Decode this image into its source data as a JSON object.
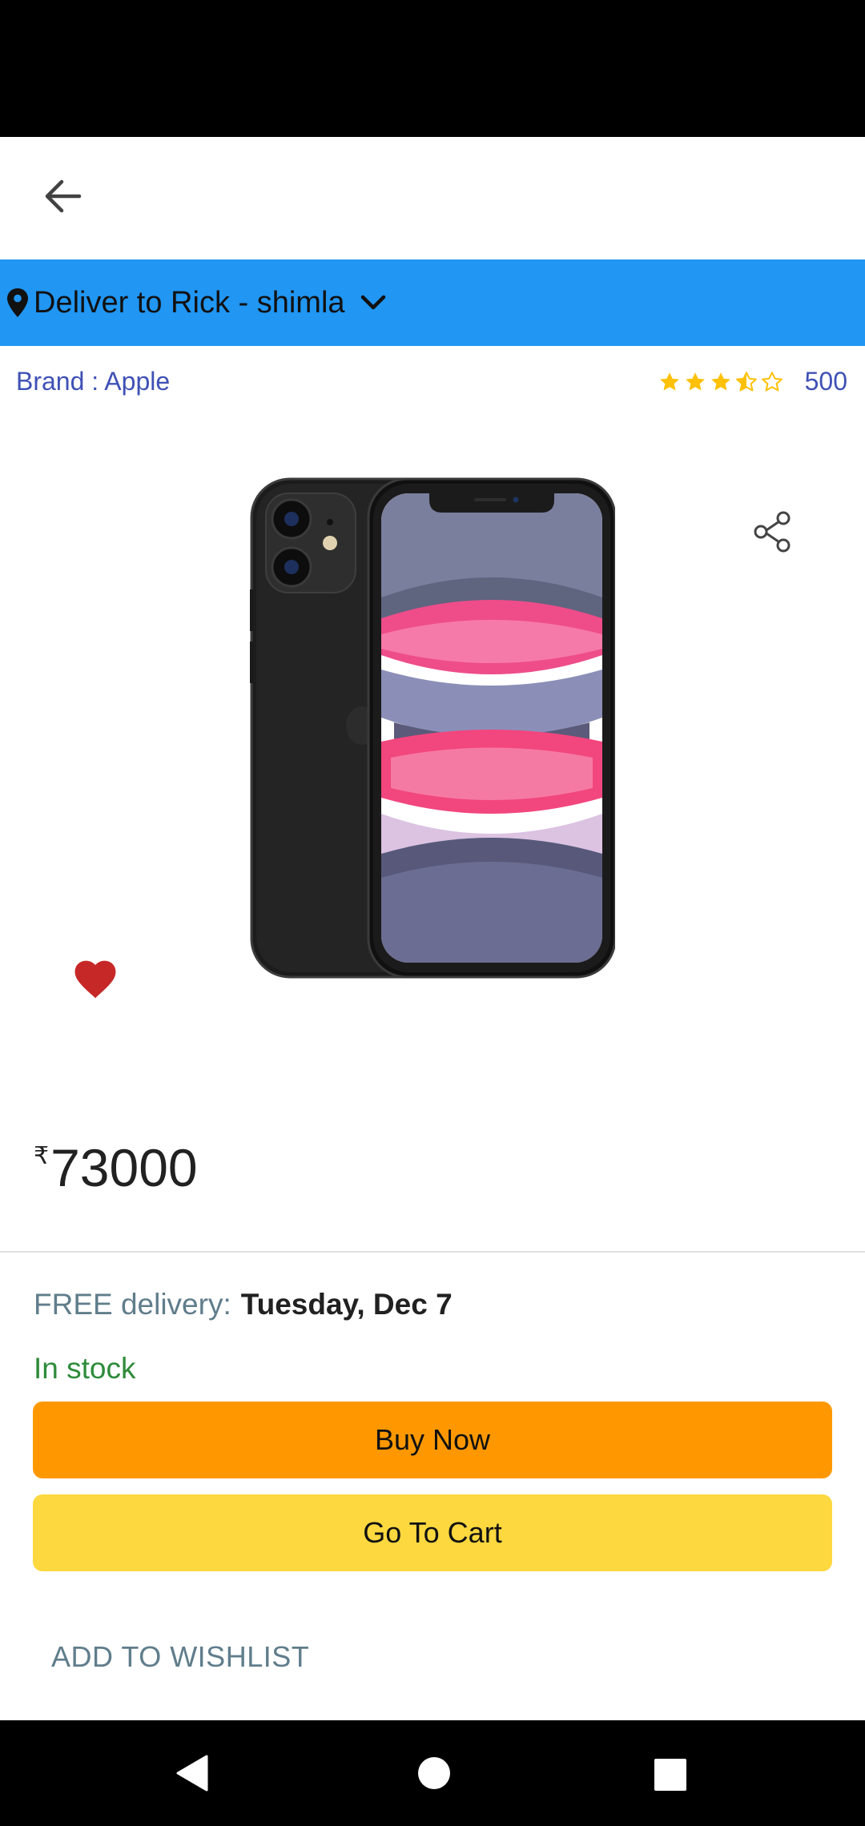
{
  "header": {
    "back_icon": "arrow-back-icon"
  },
  "delivery_bar": {
    "text": "Deliver to Rick - shimla",
    "pin_icon": "location-pin-icon",
    "chevron_icon": "chevron-down-icon",
    "color": "#2196f3"
  },
  "product": {
    "brand": "Brand : Apple",
    "rating": 3.5,
    "rating_max": 5,
    "rating_count": "500",
    "image_icon": "iphone-11-black-product-image",
    "currency": "₹",
    "price": "73000"
  },
  "delivery": {
    "label": "FREE delivery:",
    "date": "Tuesday, Dec 7"
  },
  "stock": {
    "text": "In stock",
    "color": "#2e8b3a"
  },
  "actions": {
    "buy_now": "Buy Now",
    "buy_now_color": "#ff9800",
    "go_to_cart": "Go To Cart",
    "go_to_cart_color": "#fdd83f",
    "wishlist": "ADD TO WISHLIST"
  },
  "icons": {
    "share": "share-icon",
    "favorite": "heart-icon"
  },
  "system_nav": {
    "back": "nav-back-icon",
    "home": "nav-home-icon",
    "recents": "nav-recents-icon"
  }
}
